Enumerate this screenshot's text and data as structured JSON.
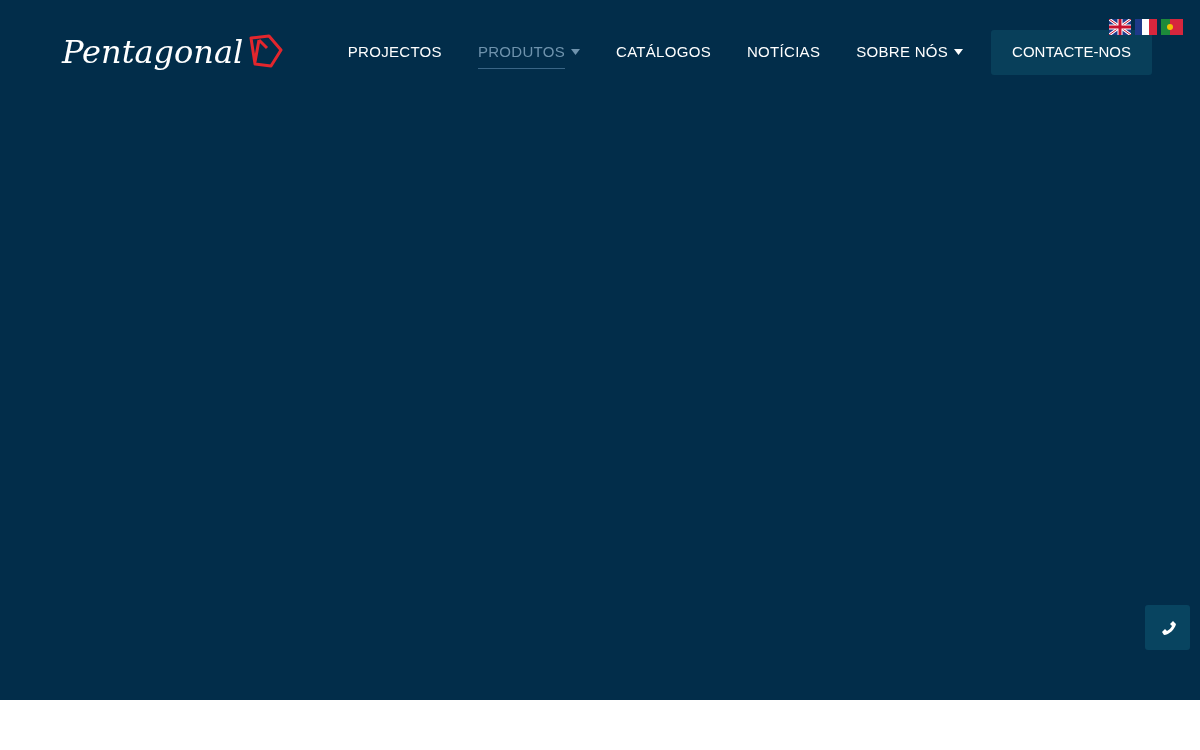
{
  "header": {
    "logo": "Pentagonal",
    "nav": [
      {
        "label": "PROJECTOS",
        "selected": false,
        "dropdown": false
      },
      {
        "label": "PRODUTOS",
        "selected": true,
        "dropdown": true
      },
      {
        "label": "CATÁLOGOS",
        "selected": false,
        "dropdown": false
      },
      {
        "label": "NOTÍCIAS",
        "selected": false,
        "dropdown": false
      },
      {
        "label": "SOBRE NÓS",
        "selected": false,
        "dropdown": true
      }
    ],
    "cta": "CONTACTE-NOS",
    "languages": [
      {
        "kind": "en"
      },
      {
        "kind": "fr"
      },
      {
        "kind": "pt"
      }
    ]
  }
}
